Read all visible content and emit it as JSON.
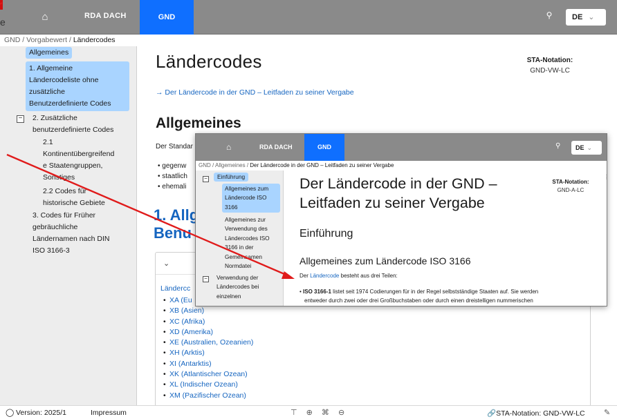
{
  "main": {
    "nav": {
      "home_icon": "home-icon",
      "rda_label": "RDA DACH",
      "gnd_tab": "GND",
      "search_icon": "search-icon",
      "language": "DE"
    },
    "breadcrumb": {
      "part1": "GND",
      "sep1": " / ",
      "part2": "Vorgabewert",
      "sep2": " / ",
      "current": "Ländercodes"
    },
    "sidebar": {
      "item_allgemeines": "Allgemeines",
      "item1": [
        "1. Allgemeine",
        "Ländercodeliste ohne",
        "zusätzliche",
        "Benutzerdefinierte Codes"
      ],
      "toggle2": "−",
      "item2": [
        "2. Zusätzliche",
        "benutzerdefinierte Codes"
      ],
      "item21": [
        "2.1",
        "Kontinentübergreifend",
        "e Staatengruppen,",
        "Sonstiges"
      ],
      "item22": [
        "2.2 Codes für",
        "historische Gebiete"
      ],
      "item3": [
        "3. Codes für Früher",
        "gebräuchliche",
        "Ländernamen nach DIN",
        "ISO 3166-3"
      ]
    },
    "title": "Ländercodes",
    "sta_label": "STA-Notation:",
    "sta_value": "GND-VW-LC",
    "leitfaden_link": "→ Der Ländercode in der GND – Leitfaden zu seiner Vergabe",
    "h_allgemeines": "Allgemeines",
    "standard_text": "Der Standar",
    "bullets": [
      "gegenw",
      "staatlich",
      "ehemali"
    ],
    "h_one": [
      "1. Allg",
      "Benu"
    ],
    "card_chevron": "⌄",
    "codes_heading": "Ländercc",
    "codes": [
      "XA (Eu",
      "XB (Asien)",
      "XC (Afrika)",
      "XD (Amerika)",
      "XE (Australien, Ozeanien)",
      "XH (Arktis)",
      "XI (Antarktis)",
      "XK (Atlantischer Ozean)",
      "XL (Indischer Ozean)",
      "XM (Pazifischer Ozean)"
    ],
    "footer": {
      "github_icon": "github-icon",
      "version": "Version: 2025/1",
      "impressum": "Impressum",
      "tools": "⊤ ⊕ ⌘ ⊖",
      "sta_notation": "🔗STA-Notation: GND-VW-LC",
      "edit_icon": "edit-icon"
    }
  },
  "overlay": {
    "nav": {
      "rda_label": "RDA DACH",
      "gnd_tab": "GND",
      "language": "DE"
    },
    "breadcrumb": {
      "part1": "GND",
      "sep1": " / ",
      "part2": "Allgemeines",
      "sep2": " / ",
      "current": "Der Ländercode in der GND – Leitfaden zu seiner Vergabe"
    },
    "sidebar": {
      "toggle1": "−",
      "item_einf": "Einführung",
      "item_allg_iso": [
        "Allgemeines zum",
        "Ländercode ISO",
        "3166"
      ],
      "item_allg_zur": [
        "Allgemeines zur",
        "Verwendung des",
        "Ländercodes ISO",
        "3166 in der",
        "Gemeinsamen",
        "Normdatei"
      ],
      "toggle2": "−",
      "item_verw": [
        "Verwendung der",
        "Ländercodes bei",
        "einzelnen"
      ]
    },
    "title": [
      "Der Ländercode in der GND –",
      "Leitfaden zu seiner Vergabe"
    ],
    "sta_label": "STA-Notation:",
    "sta_value": "GND-A-LC",
    "scroll_indicator": "⋮",
    "h_einf": "Einführung",
    "h_allg_iso": "Allgemeines zum Ländercode ISO 3166",
    "para_pre": "Der ",
    "para_link": "Ländercode",
    "para_post": " besteht aus drei Teilen:",
    "list_bold": "ISO 3166-1",
    "list_text1": " listet seit 1974 Codierungen für in der Regel selbstständige Staaten auf. Sie werden",
    "list_text2": "entweder durch zwei oder drei Großbuchstaben oder durch einen dreistelligen nummerischen"
  },
  "annotation": {
    "arrow_color": "#e01b1b"
  },
  "colors": {
    "accent": "#0f6fff",
    "link": "#1565c0",
    "sidebar_highlight": "#a9d4ff",
    "header": "#8a8a8a"
  }
}
